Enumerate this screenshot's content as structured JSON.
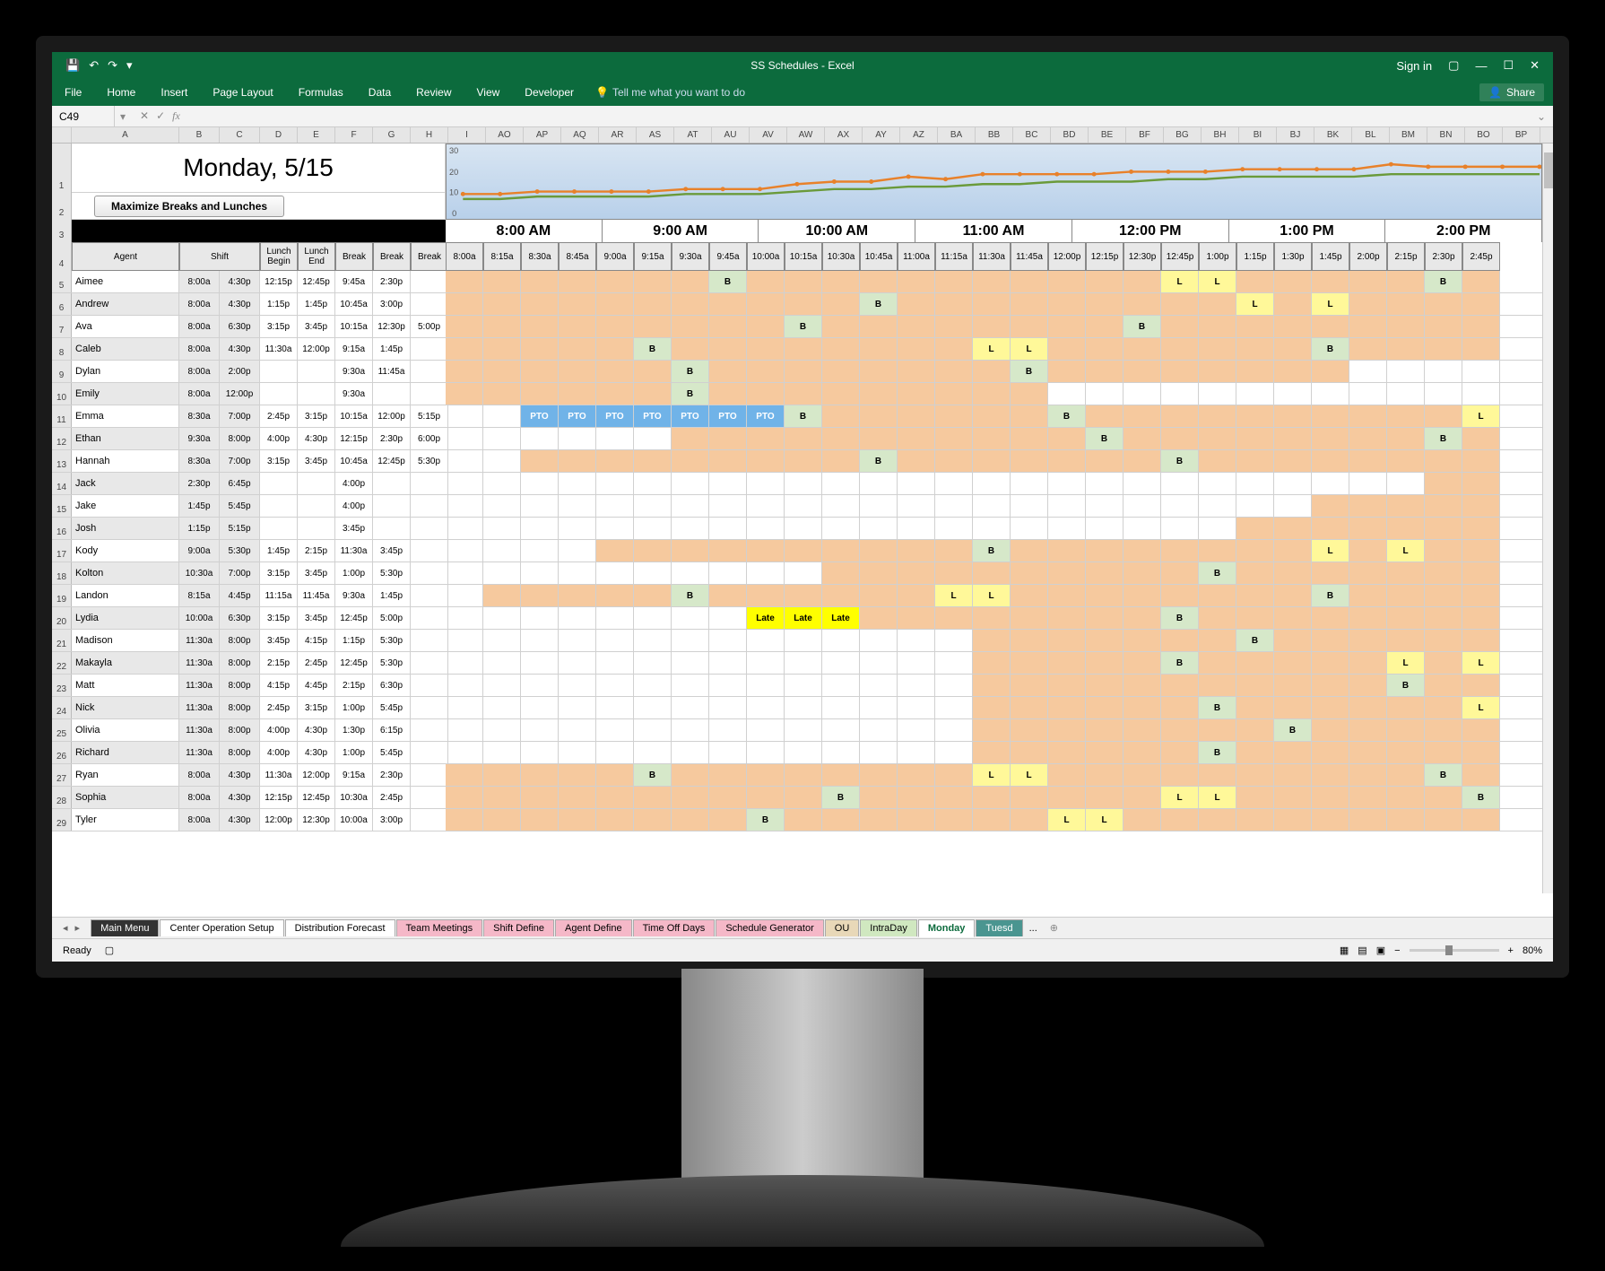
{
  "app_title": "SS Schedules - Excel",
  "signin": "Sign in",
  "namebox": "C49",
  "share": "Share",
  "ribbon": [
    "File",
    "Home",
    "Insert",
    "Page Layout",
    "Formulas",
    "Data",
    "Review",
    "View",
    "Developer"
  ],
  "tell_me": "Tell me what you want to do",
  "title": "Monday, 5/15",
  "button": "Maximize Breaks and Lunches",
  "col_letters_left": [
    "A",
    "B",
    "C",
    "D",
    "E",
    "F",
    "G",
    "H",
    "I"
  ],
  "col_letters_right": [
    "AO",
    "AP",
    "AQ",
    "AR",
    "AS",
    "AT",
    "AU",
    "AV",
    "AW",
    "AX",
    "AY",
    "AZ",
    "BA",
    "BB",
    "BC",
    "BD",
    "BE",
    "BF",
    "BG",
    "BH",
    "BI",
    "BJ",
    "BK",
    "BL",
    "BM",
    "BN",
    "BO",
    "BP"
  ],
  "hours": [
    "8:00 AM",
    "9:00 AM",
    "10:00 AM",
    "11:00 AM",
    "12:00 PM",
    "1:00 PM",
    "2:00 PM"
  ],
  "time_slots": [
    "8:00a",
    "8:15a",
    "8:30a",
    "8:45a",
    "9:00a",
    "9:15a",
    "9:30a",
    "9:45a",
    "10:00a",
    "10:15a",
    "10:30a",
    "10:45a",
    "11:00a",
    "11:15a",
    "11:30a",
    "11:45a",
    "12:00p",
    "12:15p",
    "12:30p",
    "12:45p",
    "1:00p",
    "1:15p",
    "1:30p",
    "1:45p",
    "2:00p",
    "2:15p",
    "2:30p",
    "2:45p"
  ],
  "sub_headers": {
    "agent": "Agent",
    "shift": "Shift",
    "lunch_begin": "Lunch Begin",
    "lunch_end": "Lunch End",
    "break": "Break"
  },
  "agents": [
    {
      "n": 5,
      "name": "Aimee",
      "shift": [
        "8:00a",
        "4:30p"
      ],
      "lunch": [
        "12:15p",
        "12:45p"
      ],
      "breaks": [
        "9:45a",
        "2:30p",
        ""
      ],
      "tl": {
        "7": "B",
        "19": "L",
        "20": "L",
        "26": "B"
      }
    },
    {
      "n": 6,
      "name": "Andrew",
      "shift": [
        "8:00a",
        "4:30p"
      ],
      "lunch": [
        "1:15p",
        "1:45p"
      ],
      "breaks": [
        "10:45a",
        "3:00p",
        ""
      ],
      "tl": {
        "11": "B",
        "21": "L",
        "23": "L"
      },
      "grey": true
    },
    {
      "n": 7,
      "name": "Ava",
      "shift": [
        "8:00a",
        "6:30p"
      ],
      "lunch": [
        "3:15p",
        "3:45p"
      ],
      "breaks": [
        "10:15a",
        "12:30p",
        "5:00p"
      ],
      "tl": {
        "9": "B",
        "18": "B"
      }
    },
    {
      "n": 8,
      "name": "Caleb",
      "shift": [
        "8:00a",
        "4:30p"
      ],
      "lunch": [
        "11:30a",
        "12:00p"
      ],
      "breaks": [
        "9:15a",
        "1:45p",
        ""
      ],
      "tl": {
        "5": "B",
        "14": "L",
        "15": "L",
        "23": "B"
      },
      "grey": true
    },
    {
      "n": 9,
      "name": "Dylan",
      "shift": [
        "8:00a",
        "2:00p"
      ],
      "lunch": [
        "",
        ""
      ],
      "breaks": [
        "9:30a",
        "11:45a",
        ""
      ],
      "tl": {
        "6": "B",
        "15": "B"
      },
      "range": [
        0,
        24
      ]
    },
    {
      "n": 10,
      "name": "Emily",
      "shift": [
        "8:00a",
        "12:00p"
      ],
      "lunch": [
        "",
        ""
      ],
      "breaks": [
        "9:30a",
        "",
        ""
      ],
      "tl": {
        "6": "B"
      },
      "grey": true,
      "range": [
        0,
        16
      ]
    },
    {
      "n": 11,
      "name": "Emma",
      "shift": [
        "8:30a",
        "7:00p"
      ],
      "lunch": [
        "2:45p",
        "3:15p"
      ],
      "breaks": [
        "10:15a",
        "12:00p",
        "5:15p"
      ],
      "tl": {
        "9": "B",
        "16": "B",
        "27": "L"
      },
      "pto": [
        2,
        3,
        4,
        5,
        6,
        7,
        8
      ],
      "startcol": 2
    },
    {
      "n": 12,
      "name": "Ethan",
      "shift": [
        "9:30a",
        "8:00p"
      ],
      "lunch": [
        "4:00p",
        "4:30p"
      ],
      "breaks": [
        "12:15p",
        "2:30p",
        "6:00p"
      ],
      "tl": {
        "17": "B",
        "26": "B"
      },
      "grey": true,
      "startcol": 6
    },
    {
      "n": 13,
      "name": "Hannah",
      "shift": [
        "8:30a",
        "7:00p"
      ],
      "lunch": [
        "3:15p",
        "3:45p"
      ],
      "breaks": [
        "10:45a",
        "12:45p",
        "5:30p"
      ],
      "tl": {
        "11": "B",
        "19": "B"
      },
      "startcol": 2
    },
    {
      "n": 14,
      "name": "Jack",
      "shift": [
        "2:30p",
        "6:45p"
      ],
      "lunch": [
        "",
        ""
      ],
      "breaks": [
        "4:00p",
        "",
        ""
      ],
      "tl": {},
      "grey": true,
      "startcol": 26
    },
    {
      "n": 15,
      "name": "Jake",
      "shift": [
        "1:45p",
        "5:45p"
      ],
      "lunch": [
        "",
        ""
      ],
      "breaks": [
        "4:00p",
        "",
        ""
      ],
      "tl": {},
      "startcol": 23
    },
    {
      "n": 16,
      "name": "Josh",
      "shift": [
        "1:15p",
        "5:15p"
      ],
      "lunch": [
        "",
        ""
      ],
      "breaks": [
        "3:45p",
        "",
        ""
      ],
      "tl": {},
      "grey": true,
      "startcol": 21
    },
    {
      "n": 17,
      "name": "Kody",
      "shift": [
        "9:00a",
        "5:30p"
      ],
      "lunch": [
        "1:45p",
        "2:15p"
      ],
      "breaks": [
        "11:30a",
        "3:45p",
        ""
      ],
      "tl": {
        "14": "B",
        "23": "L",
        "25": "L"
      },
      "startcol": 4
    },
    {
      "n": 18,
      "name": "Kolton",
      "shift": [
        "10:30a",
        "7:00p"
      ],
      "lunch": [
        "3:15p",
        "3:45p"
      ],
      "breaks": [
        "1:00p",
        "5:30p",
        ""
      ],
      "tl": {
        "20": "B"
      },
      "grey": true,
      "startcol": 10
    },
    {
      "n": 19,
      "name": "Landon",
      "shift": [
        "8:15a",
        "4:45p"
      ],
      "lunch": [
        "11:15a",
        "11:45a"
      ],
      "breaks": [
        "9:30a",
        "1:45p",
        ""
      ],
      "tl": {
        "6": "B",
        "13": "L",
        "14": "L",
        "23": "B"
      },
      "startcol": 1
    },
    {
      "n": 20,
      "name": "Lydia",
      "shift": [
        "10:00a",
        "6:30p"
      ],
      "lunch": [
        "3:15p",
        "3:45p"
      ],
      "breaks": [
        "12:45p",
        "5:00p",
        ""
      ],
      "tl": {
        "19": "B"
      },
      "grey": true,
      "late": [
        8,
        9,
        10
      ],
      "startcol": 8
    },
    {
      "n": 21,
      "name": "Madison",
      "shift": [
        "11:30a",
        "8:00p"
      ],
      "lunch": [
        "3:45p",
        "4:15p"
      ],
      "breaks": [
        "1:15p",
        "5:30p",
        ""
      ],
      "tl": {
        "21": "B"
      },
      "startcol": 14
    },
    {
      "n": 22,
      "name": "Makayla",
      "shift": [
        "11:30a",
        "8:00p"
      ],
      "lunch": [
        "2:15p",
        "2:45p"
      ],
      "breaks": [
        "12:45p",
        "5:30p",
        ""
      ],
      "tl": {
        "19": "B",
        "25": "L",
        "27": "L"
      },
      "grey": true,
      "startcol": 14
    },
    {
      "n": 23,
      "name": "Matt",
      "shift": [
        "11:30a",
        "8:00p"
      ],
      "lunch": [
        "4:15p",
        "4:45p"
      ],
      "breaks": [
        "2:15p",
        "6:30p",
        ""
      ],
      "tl": {
        "25": "B"
      },
      "startcol": 14
    },
    {
      "n": 24,
      "name": "Nick",
      "shift": [
        "11:30a",
        "8:00p"
      ],
      "lunch": [
        "2:45p",
        "3:15p"
      ],
      "breaks": [
        "1:00p",
        "5:45p",
        ""
      ],
      "tl": {
        "20": "B",
        "27": "L"
      },
      "grey": true,
      "startcol": 14
    },
    {
      "n": 25,
      "name": "Olivia",
      "shift": [
        "11:30a",
        "8:00p"
      ],
      "lunch": [
        "4:00p",
        "4:30p"
      ],
      "breaks": [
        "1:30p",
        "6:15p",
        ""
      ],
      "tl": {
        "22": "B"
      },
      "startcol": 14
    },
    {
      "n": 26,
      "name": "Richard",
      "shift": [
        "11:30a",
        "8:00p"
      ],
      "lunch": [
        "4:00p",
        "4:30p"
      ],
      "breaks": [
        "1:00p",
        "5:45p",
        ""
      ],
      "tl": {
        "20": "B"
      },
      "grey": true,
      "startcol": 14
    },
    {
      "n": 27,
      "name": "Ryan",
      "shift": [
        "8:00a",
        "4:30p"
      ],
      "lunch": [
        "11:30a",
        "12:00p"
      ],
      "breaks": [
        "9:15a",
        "2:30p",
        ""
      ],
      "tl": {
        "5": "B",
        "14": "L",
        "15": "L",
        "26": "B"
      }
    },
    {
      "n": 28,
      "name": "Sophia",
      "shift": [
        "8:00a",
        "4:30p"
      ],
      "lunch": [
        "12:15p",
        "12:45p"
      ],
      "breaks": [
        "10:30a",
        "2:45p",
        ""
      ],
      "tl": {
        "10": "B",
        "19": "L",
        "20": "L",
        "27": "B"
      },
      "grey": true
    },
    {
      "n": 29,
      "name": "Tyler",
      "shift": [
        "8:00a",
        "4:30p"
      ],
      "lunch": [
        "12:00p",
        "12:30p"
      ],
      "breaks": [
        "10:00a",
        "3:00p",
        ""
      ],
      "tl": {
        "8": "B",
        "16": "L",
        "17": "L"
      }
    }
  ],
  "sheet_tabs": [
    {
      "label": "Main Menu",
      "cls": "dark"
    },
    {
      "label": "Center Operation Setup",
      "cls": ""
    },
    {
      "label": "Distribution Forecast",
      "cls": ""
    },
    {
      "label": "Team Meetings",
      "cls": "pink"
    },
    {
      "label": "Shift Define",
      "cls": "pink"
    },
    {
      "label": "Agent Define",
      "cls": "pink"
    },
    {
      "label": "Time Off Days",
      "cls": "pink"
    },
    {
      "label": "Schedule Generator",
      "cls": "pink"
    },
    {
      "label": "OU",
      "cls": "tan"
    },
    {
      "label": "IntraDay",
      "cls": "lgreen"
    },
    {
      "label": "Monday",
      "cls": "active"
    },
    {
      "label": "Tuesd",
      "cls": "teal"
    }
  ],
  "status": {
    "ready": "Ready",
    "zoom": "80%"
  },
  "chart_data": {
    "type": "line",
    "ylim": [
      0,
      30
    ],
    "yticks": [
      0,
      10,
      20,
      30
    ],
    "series": [
      {
        "name": "orange",
        "color": "#e8812a",
        "values": [
          10,
          10,
          11,
          11,
          11,
          11,
          12,
          12,
          12,
          14,
          15,
          15,
          17,
          16,
          18,
          18,
          18,
          18,
          19,
          19,
          19,
          20,
          20,
          20,
          20,
          22,
          21,
          21,
          21,
          21
        ]
      },
      {
        "name": "green",
        "color": "#6a9a3a",
        "values": [
          8,
          8,
          9,
          9,
          9,
          9,
          10,
          10,
          10,
          11,
          12,
          12,
          13,
          13,
          14,
          14,
          15,
          15,
          15,
          16,
          16,
          17,
          17,
          17,
          17,
          18,
          18,
          18,
          18,
          18
        ]
      }
    ]
  }
}
